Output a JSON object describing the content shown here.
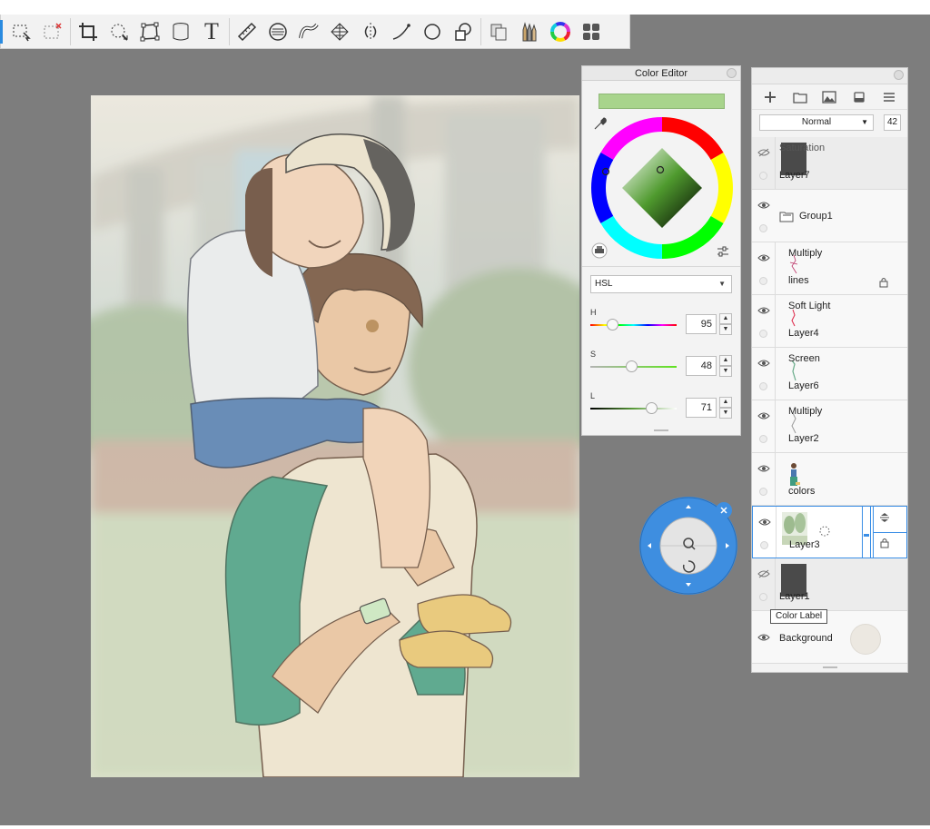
{
  "toolbar": {
    "tools": [
      "select-icon",
      "marquee-icon",
      "crop-icon",
      "lasso-icon",
      "transform-icon",
      "fill-bucket-icon",
      "text-icon",
      "ruler-icon",
      "symmetry-icon",
      "curve-ruler-icon",
      "perspective-icon",
      "mirror-icon",
      "stroke-icon",
      "ellipse-icon",
      "shape-icon",
      "copy-icon",
      "brush-icon",
      "color-wheel-icon",
      "panels-icon"
    ],
    "text_tool_label": "T"
  },
  "color_editor": {
    "title": "Color Editor",
    "current_color": "#a8d48c",
    "mode": "HSL",
    "h_label": "H",
    "h_value": "95",
    "s_label": "S",
    "s_value": "48",
    "l_label": "L",
    "l_value": "71",
    "h_fraction": 0.26,
    "s_fraction": 0.48,
    "l_fraction": 0.71
  },
  "layer_panel": {
    "blend_mode": "Normal",
    "opacity": "42",
    "layers": [
      {
        "mode": "Saturation",
        "name": "Layer7",
        "visible": false,
        "thumb": "dark"
      },
      {
        "mode": "",
        "name": "Group1",
        "visible": true,
        "thumb": "folder"
      },
      {
        "mode": "Multiply",
        "name": "lines",
        "visible": true,
        "thumb": "sketch",
        "locked": true
      },
      {
        "mode": "Soft Light",
        "name": "Layer4",
        "visible": true,
        "thumb": "sketch"
      },
      {
        "mode": "Screen",
        "name": "Layer6",
        "visible": true,
        "thumb": "sketch"
      },
      {
        "mode": "Multiply",
        "name": "Layer2",
        "visible": true,
        "thumb": "sketch"
      },
      {
        "mode": "",
        "name": "colors",
        "visible": true,
        "thumb": "figure"
      },
      {
        "mode": "",
        "name": "Layer3",
        "visible": true,
        "thumb": "trees",
        "selected": true
      },
      {
        "mode": "",
        "name": "Layer1",
        "visible": false,
        "thumb": "dark"
      },
      {
        "mode": "",
        "name": "Background",
        "visible": true,
        "thumb": "circle"
      }
    ],
    "tooltip": "Color Label"
  },
  "navigator": {
    "zoom_icon": "magnifier-icon",
    "rotate_icon": "rotate-icon"
  },
  "colors": {
    "accent": "#2a8be0",
    "workspace": "#7d7d7d"
  }
}
